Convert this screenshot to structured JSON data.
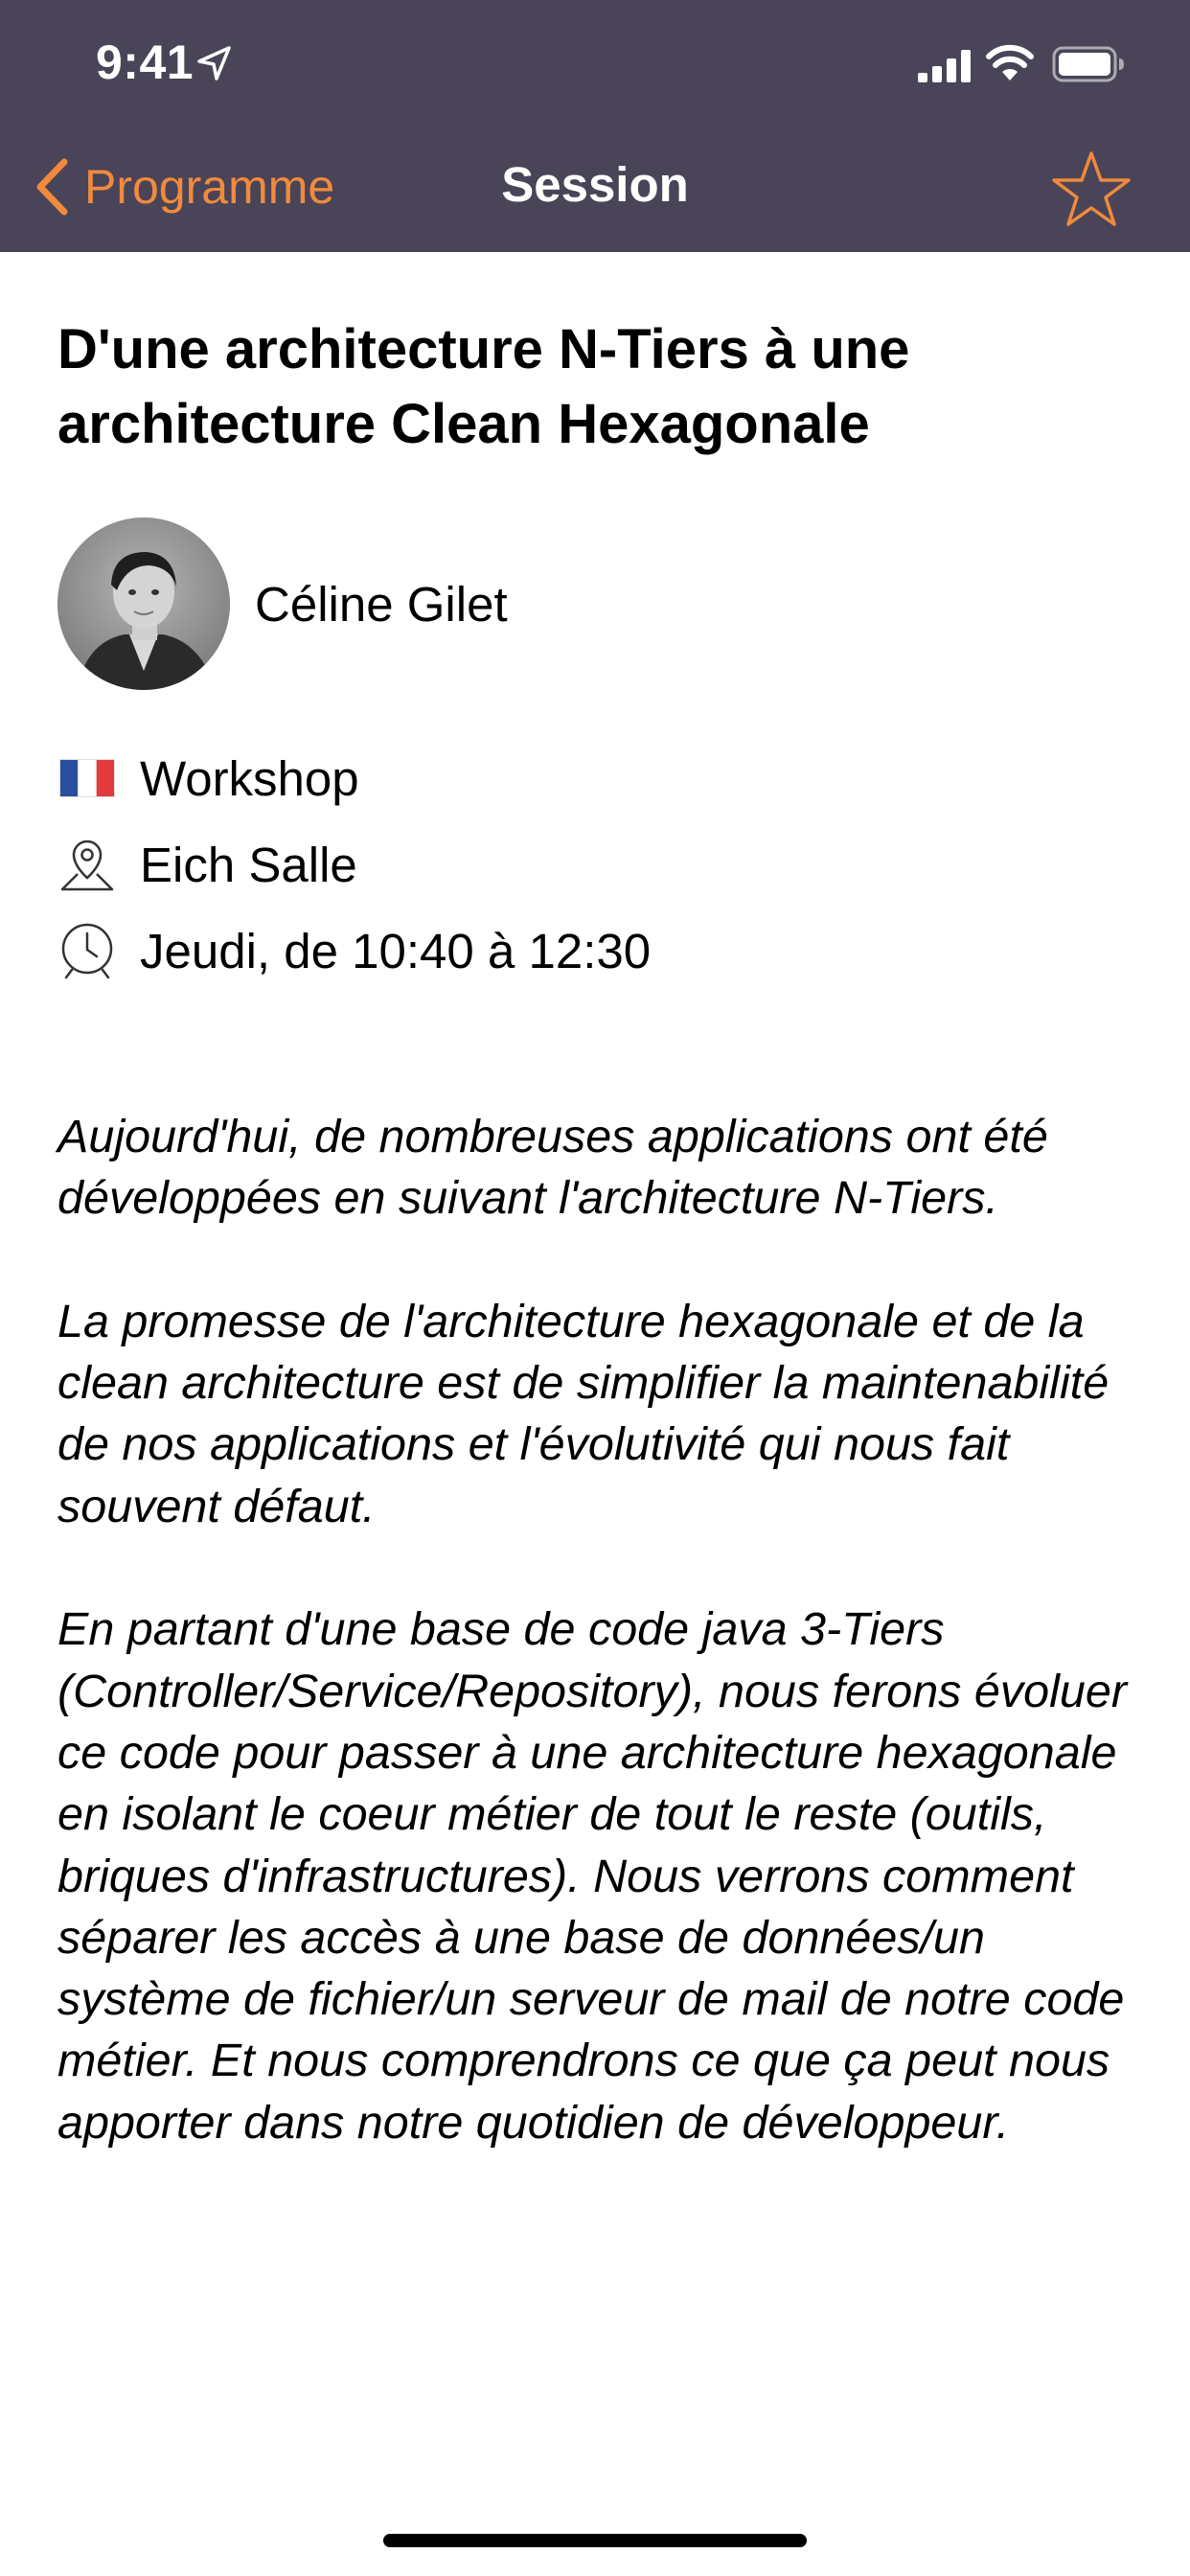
{
  "status_bar": {
    "time": "9:41"
  },
  "nav": {
    "back_label": "Programme",
    "title": "Session"
  },
  "session": {
    "title": "D'une architecture N-Tiers à une architecture Clean Hexagonale",
    "speaker": "Céline Gilet",
    "format": "Workshop",
    "language_icon": "french-flag-icon",
    "room": "Eich Salle",
    "time": "Jeudi, de 10:40 à 12:30",
    "description": [
      "Aujourd'hui, de nombreuses applications ont été développées en suivant l'architecture N-Tiers.",
      "La promesse de l'architecture hexagonale et de la clean architecture est de simplifier la maintenabilité de nos applications et l'évolutivité qui nous fait souvent défaut.",
      "En partant d'une base de code java 3-Tiers (Controller/Service/Repository), nous ferons évoluer ce code pour passer à une architecture hexagonale en isolant le coeur métier de tout le reste (outils, briques d'infrastructures). Nous verrons comment séparer les accès à une base de données/un système de fichier/un serveur de mail de notre code métier. Et nous comprendrons ce que ça peut nous apporter dans notre quotidien de développeur."
    ]
  },
  "colors": {
    "nav_background": "#4a4458",
    "accent": "#f08a3c",
    "text": "#000000",
    "background": "#ffffff"
  },
  "icons": [
    "location-arrow-icon",
    "cellular-signal-icon",
    "wifi-icon",
    "battery-icon",
    "chevron-left-icon",
    "star-outline-icon",
    "french-flag-icon",
    "map-pin-icon",
    "clock-icon"
  ]
}
